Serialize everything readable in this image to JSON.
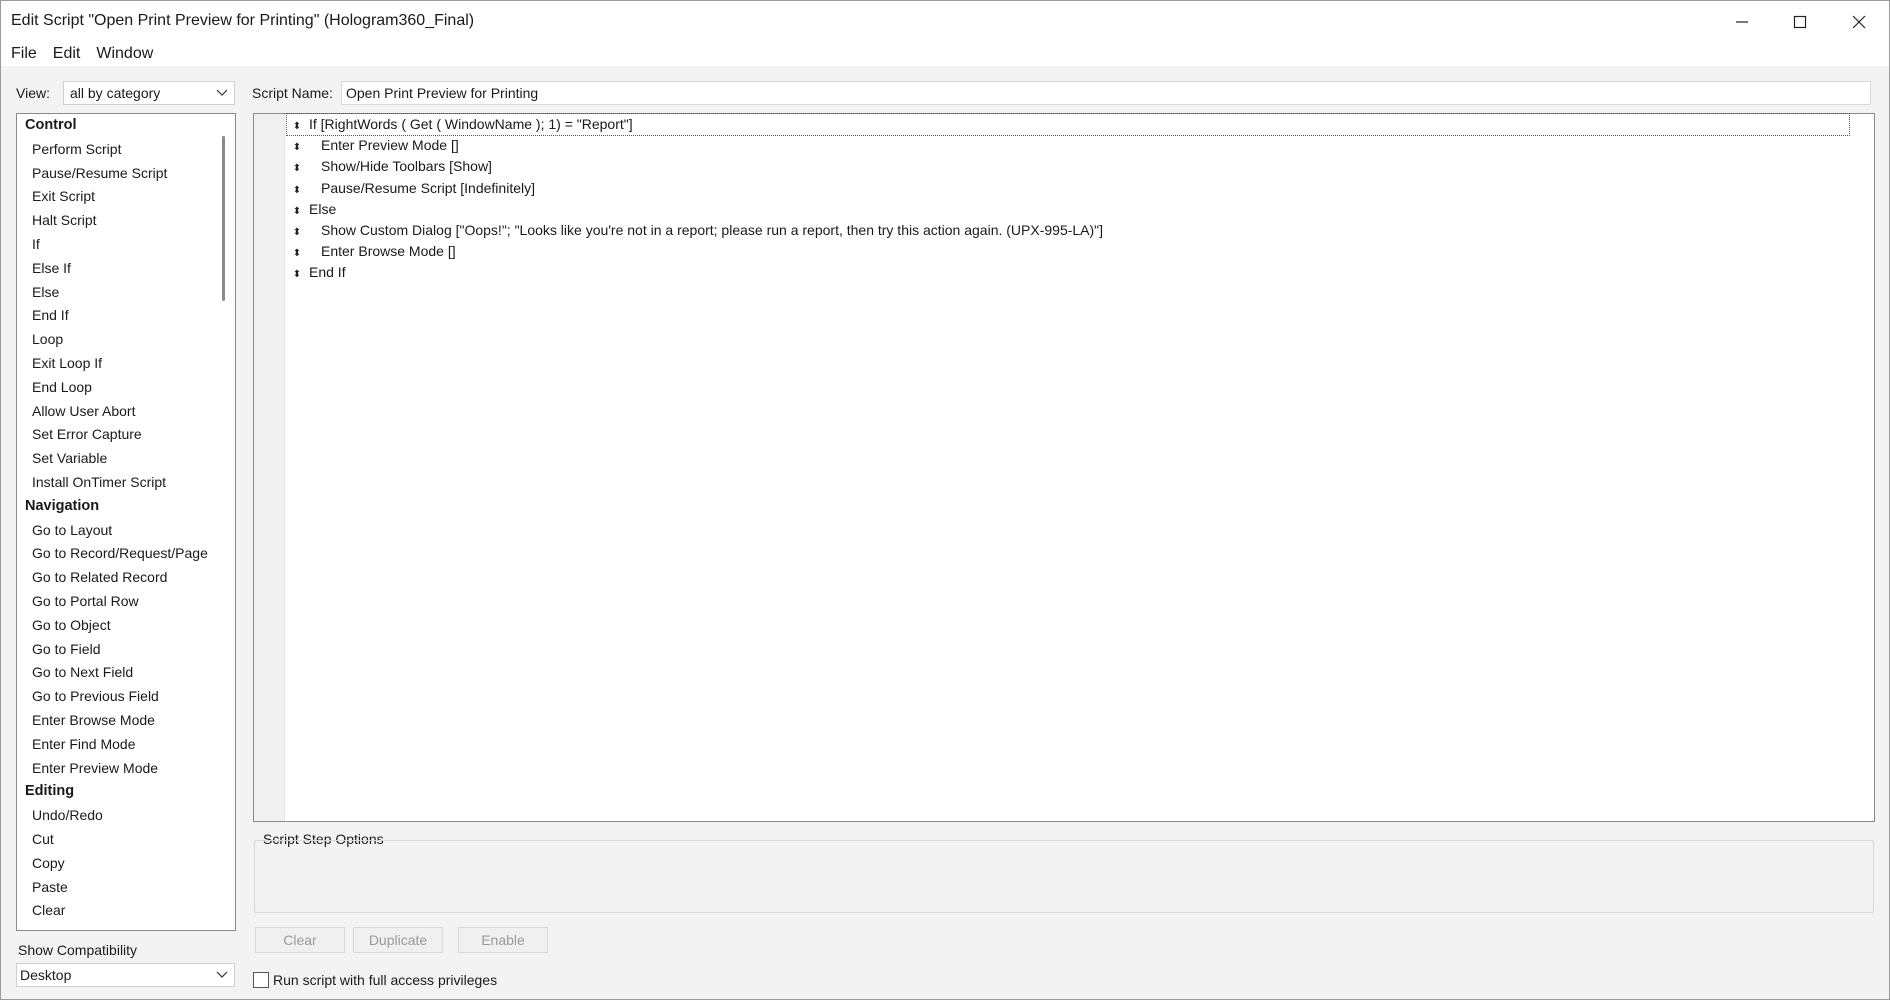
{
  "window": {
    "title": "Edit Script \"Open Print Preview for Printing\" (Hologram360_Final)"
  },
  "menu": [
    "File",
    "Edit",
    "Window"
  ],
  "view": {
    "label": "View:",
    "value": "all by category"
  },
  "script_name": {
    "label": "Script Name:",
    "value": "Open Print Preview for Printing"
  },
  "steps_panel": {
    "groups": [
      {
        "category": "Control",
        "items": [
          "Perform Script",
          "Pause/Resume Script",
          "Exit Script",
          "Halt Script",
          "If",
          "Else If",
          "Else",
          "End If",
          "Loop",
          "Exit Loop If",
          "End Loop",
          "Allow User Abort",
          "Set Error Capture",
          "Set Variable",
          "Install OnTimer Script"
        ]
      },
      {
        "category": "Navigation",
        "items": [
          "Go to Layout",
          "Go to Record/Request/Page",
          "Go to Related Record",
          "Go to Portal Row",
          "Go to Object",
          "Go to Field",
          "Go to Next Field",
          "Go to Previous Field",
          "Enter Browse Mode",
          "Enter Find Mode",
          "Enter Preview Mode"
        ]
      },
      {
        "category": "Editing",
        "items": [
          "Undo/Redo",
          "Cut",
          "Copy",
          "Paste",
          "Clear"
        ]
      }
    ]
  },
  "compatibility": {
    "label": "Show Compatibility",
    "value": "Desktop"
  },
  "script_lines": [
    {
      "text": "If [RightWords ( Get ( WindowName ); 1) = \"Report\"]",
      "indent": 0,
      "selected": true
    },
    {
      "text": "Enter Preview Mode []",
      "indent": 1
    },
    {
      "text": "Show/Hide Toolbars [Show]",
      "indent": 1
    },
    {
      "text": "Pause/Resume Script [Indefinitely]",
      "indent": 1
    },
    {
      "text": "Else",
      "indent": 0
    },
    {
      "text": "Show Custom Dialog [\"Oops!\"; \"Looks like you're not in a report; please run a report, then try this action again. (UPX-995-LA)\"]",
      "indent": 1
    },
    {
      "text": "Enter Browse Mode []",
      "indent": 1
    },
    {
      "text": "End If",
      "indent": 0
    }
  ],
  "options": {
    "label": "Script Step Options"
  },
  "buttons": {
    "clear": "Clear",
    "duplicate": "Duplicate",
    "enable": "Enable"
  },
  "full_access": {
    "label": "Run script with full access privileges",
    "checked": false
  }
}
